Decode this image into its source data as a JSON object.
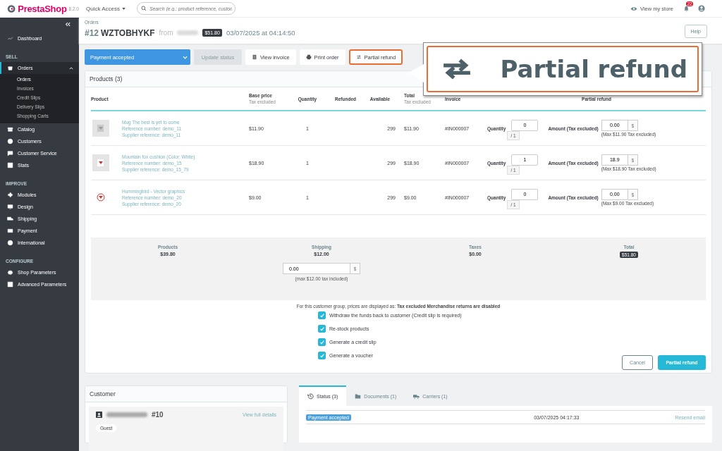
{
  "header": {
    "logo": "PrestaShop",
    "version": "8.2.0",
    "quick_access": "Quick Access",
    "search": {
      "placeholder": "Search (e.g.: product reference, custon"
    },
    "view_store": "View my store",
    "notifications": "22"
  },
  "sidebar": {
    "sections": [
      {
        "items": [
          {
            "label": "Dashboard",
            "selected": false
          }
        ]
      },
      {
        "title": "SELL",
        "items": [
          {
            "label": "Orders",
            "selected": true,
            "expanded": true,
            "children": [
              {
                "label": "Orders",
                "selected": true
              },
              {
                "label": "Invoices",
                "selected": false
              },
              {
                "label": "Credit Slips",
                "selected": false
              },
              {
                "label": "Delivery Slips",
                "selected": false
              },
              {
                "label": "Shopping Carts",
                "selected": false
              }
            ]
          },
          {
            "label": "Catalog",
            "selected": false
          },
          {
            "label": "Customers",
            "selected": false
          },
          {
            "label": "Customer Service",
            "selected": false
          },
          {
            "label": "Stats",
            "selected": false
          }
        ]
      },
      {
        "title": "IMPROVE",
        "items": [
          {
            "label": "Modules",
            "selected": false
          },
          {
            "label": "Design",
            "selected": false
          },
          {
            "label": "Shipping",
            "selected": false
          },
          {
            "label": "Payment",
            "selected": false
          },
          {
            "label": "International",
            "selected": false
          }
        ]
      },
      {
        "title": "CONFIGURE",
        "items": [
          {
            "label": "Shop Parameters",
            "selected": false
          },
          {
            "label": "Advanced Parameters",
            "selected": false
          }
        ]
      }
    ]
  },
  "page": {
    "breadcrumb": "Orders",
    "order_number": "#12",
    "reference": "WZTOBHYKF",
    "from": "from",
    "total": "$51.80",
    "date": "03/07/2025 at 04:14:50",
    "help": "Help"
  },
  "actions": {
    "status": "Payment accepted",
    "update": {
      "label": "Update status",
      "disabled": true
    },
    "buttons": [
      {
        "label": "View invoice",
        "highlighted": false
      },
      {
        "label": "Print order",
        "highlighted": false
      },
      {
        "label": "Partial refund",
        "highlighted": true
      }
    ]
  },
  "callout": {
    "label": "Partial refund"
  },
  "products": {
    "title": "Products (3)",
    "columns": [
      {
        "label": "Product"
      },
      {
        "label": "Base price",
        "sub": "Tax excluded"
      },
      {
        "label": "Quantity"
      },
      {
        "label": "Refunded"
      },
      {
        "label": "Available"
      },
      {
        "label": "Total",
        "sub": "Tax excluded"
      },
      {
        "label": "Invoice"
      },
      {
        "label": "Partial refund"
      }
    ],
    "rows": [
      {
        "name": "Mug The best is yet to come",
        "reference": "Reference number: demo_11",
        "supplier": "Supplier reference: demo_11",
        "price": "$11.90",
        "quantity": "1",
        "available": "299",
        "total": "$11.90",
        "invoice": "#IN000007",
        "qty_label": "Quantity",
        "qty_value": "0",
        "qty_max": "/ 1",
        "amount_label": "Amount (Tax excluded)",
        "amount_value": "0.00",
        "currency": "$",
        "max": "(Max $11.90 Tax excluded)"
      },
      {
        "name": "Mountain fox cushion (Color: White)",
        "reference": "Reference number: demo_15",
        "supplier": "Supplier reference: demo_15_79",
        "price": "$18.90",
        "quantity": "1",
        "available": "299",
        "total": "$18.90",
        "invoice": "#IN000007",
        "qty_label": "Quantity",
        "qty_value": "1",
        "qty_max": "/ 1",
        "amount_label": "Amount (Tax excluded)",
        "amount_value": "18.9",
        "currency": "$",
        "max": "(Max $18.90 Tax excluded)"
      },
      {
        "name": "Hummingbird - Vector graphics",
        "reference": "Reference number: demo_20",
        "supplier": "Supplier reference: demo_20",
        "price": "$9.00",
        "quantity": "1",
        "available": "299",
        "total": "$9.00",
        "invoice": "#IN000007",
        "qty_label": "Quantity",
        "qty_value": "0",
        "qty_max": "/ 1",
        "amount_label": "Amount (Tax excluded)",
        "amount_value": "0.00",
        "currency": "$",
        "max": "(Max $9.00 Tax excluded)"
      }
    ],
    "summary": [
      {
        "label": "Products",
        "value": "$39.80",
        "badge": false
      },
      {
        "label": "Shipping",
        "value": "$12.00",
        "badge": false
      },
      {
        "label": "Taxes",
        "value": "$0.00",
        "badge": false
      },
      {
        "label": "Total",
        "value": "$51.80",
        "badge": true
      }
    ],
    "shipping_refund": {
      "value": "0.00",
      "currency": "$",
      "note": "(max $12.00 tax included)"
    },
    "note": "For this customer group, prices are displayed as: **Tax excluded**  **Merchandise returns are disabled**",
    "options": [
      {
        "label": "Withdraw the funds back to customer (Credit slip is required)",
        "checked": true
      },
      {
        "label": "Re-stock products",
        "checked": true
      },
      {
        "label": "Generate a credit slip",
        "checked": true
      },
      {
        "label": "Generate a voucher",
        "checked": true
      }
    ],
    "cancel": "Cancel",
    "submit": "Partial refund"
  },
  "customer": {
    "title": "Customer",
    "id": "#10",
    "link": "View full details",
    "badge": "Guest"
  },
  "history": {
    "tabs": [
      {
        "label": "Status (3)",
        "selected": true
      },
      {
        "label": "Documents (1)",
        "selected": false
      },
      {
        "label": "Carriers (1)",
        "selected": false
      }
    ],
    "rows": [
      {
        "status": "Payment accepted",
        "color": "#4a9fdd",
        "date": "03/07/2025 04:17:33",
        "action": "Resend email"
      }
    ]
  }
}
